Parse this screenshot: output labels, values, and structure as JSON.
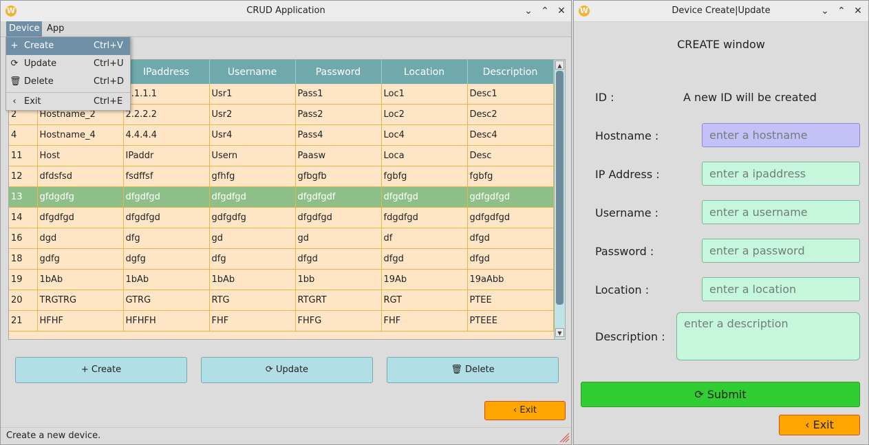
{
  "main_window": {
    "title": "CRUD Application",
    "app_icon": "W",
    "menubar": {
      "device": "Device",
      "app": "App"
    },
    "device_menu": [
      {
        "icon": "+",
        "icon_name": "plus-icon",
        "label": "Create",
        "shortcut": "Ctrl+V"
      },
      {
        "icon": "⟳",
        "icon_name": "refresh-icon",
        "label": "Update",
        "shortcut": "Ctrl+U"
      },
      {
        "icon": "🗑",
        "icon_name": "trash-icon",
        "label": "Delete",
        "shortcut": "Ctrl+D"
      },
      {
        "icon": "‹",
        "icon_name": "chevron-left-icon",
        "label": "Exit",
        "shortcut": "Ctrl+E"
      }
    ],
    "table": {
      "headers": [
        "",
        "",
        "IPaddress",
        "Username",
        "Password",
        "Location",
        "Description"
      ],
      "rows": [
        [
          "",
          "",
          "1.1.1.1",
          "Usr1",
          "Pass1",
          "Loc1",
          "Desc1"
        ],
        [
          "2",
          "Hostname_2",
          "2.2.2.2",
          "Usr2",
          "Pass2",
          "Loc2",
          "Desc2"
        ],
        [
          "4",
          "Hostname_4",
          "4.4.4.4",
          "Usr4",
          "Pass4",
          "Loc4",
          "Desc4"
        ],
        [
          "11",
          "Host",
          "IPaddr",
          "Usern",
          "Paasw",
          "Loca",
          "Desc"
        ],
        [
          "12",
          "dfdsfsd",
          "fsdffsf",
          "gfhfg",
          "gfbgfb",
          "fgbfg",
          "fgbfg"
        ],
        [
          "13",
          "gfdgdfg",
          "dfgdfgd",
          "dfgdfgd",
          "dfgdfgdf",
          "dfgdfgd",
          "gdfgdfgd"
        ],
        [
          "14",
          "dfgdfgd",
          "dfgdfgd",
          "gdfgdfg",
          "dfgdfgd",
          "fdgdfgd",
          "gdfgdfgd"
        ],
        [
          "16",
          "dgd",
          "dfg",
          "gd",
          "gd",
          "df",
          "dfgd"
        ],
        [
          "18",
          "gdfg",
          "dgfg",
          "dfg",
          "dfgd",
          "dfgd",
          "dfgd"
        ],
        [
          "19",
          "1bAb",
          "1bAb",
          "1bAb",
          "1bb",
          "19Ab",
          "19aAbb"
        ],
        [
          "20",
          "TRGTRG",
          "GTRG",
          "RTG",
          "RTGRT",
          "RGT",
          "PTEE"
        ],
        [
          "21",
          "HFHF",
          "HFHFH",
          "FHF",
          "FHFG",
          "FHF",
          "PTEEE"
        ]
      ],
      "selected_row_index": 5
    },
    "buttons": {
      "create": "Create",
      "update": "Update",
      "delete": "Delete",
      "exit": "Exit"
    },
    "status": "Create a new device."
  },
  "form_window": {
    "title": "Device Create|Update",
    "app_icon": "W",
    "heading": "CREATE window",
    "id_label": "ID :",
    "id_value": "A new ID will be created",
    "fields": {
      "hostname": {
        "label": "Hostname :",
        "placeholder": "enter a hostname"
      },
      "ipaddress": {
        "label": "IP Address :",
        "placeholder": "enter a ipaddress"
      },
      "username": {
        "label": "Username :",
        "placeholder": "enter a username"
      },
      "password": {
        "label": "Password :",
        "placeholder": "enter a password"
      },
      "location": {
        "label": "Location :",
        "placeholder": "enter a location"
      },
      "description": {
        "label": "Description :",
        "placeholder": "enter a description"
      }
    },
    "submit": "Submit",
    "exit": "Exit"
  },
  "colors": {
    "table_bg": "#fde5c5",
    "table_header": "#6fa9ab",
    "selected_row": "#8fbf88",
    "button_blue": "#b0e0e6",
    "exit_orange": "#ffa500",
    "submit_green": "#32cd32",
    "input_green": "#c6f7dc",
    "input_focus": "#c4c1f8"
  }
}
